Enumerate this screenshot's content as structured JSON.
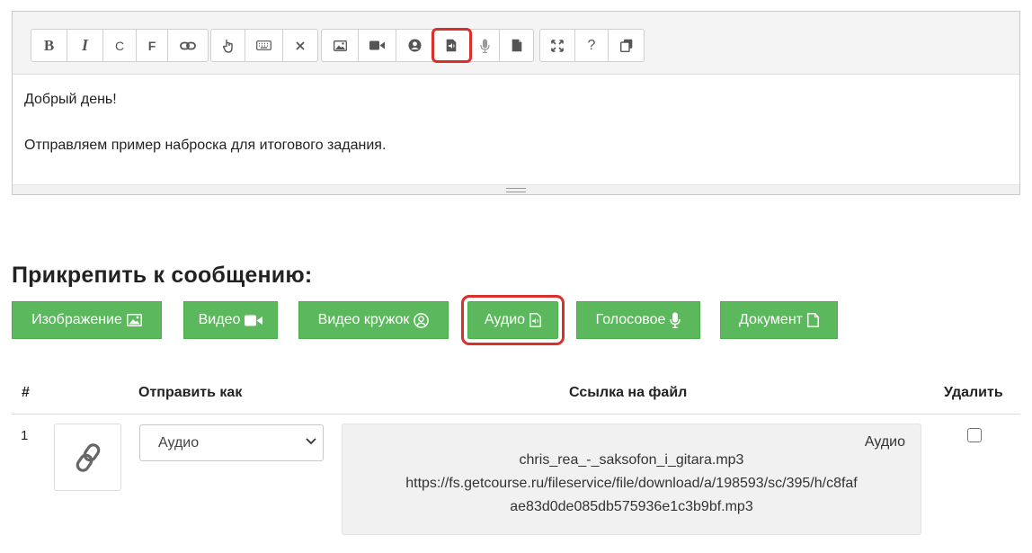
{
  "editor": {
    "toolbar": {
      "groups": [
        [
          {
            "name": "bold-button",
            "label": "B"
          },
          {
            "name": "italic-button",
            "label": "I"
          },
          {
            "name": "c-button",
            "label": "C"
          },
          {
            "name": "f-button",
            "label": "F"
          },
          {
            "name": "link-button",
            "icon": "link-icon"
          }
        ],
        [
          {
            "name": "pointer-button",
            "icon": "pointer-icon"
          },
          {
            "name": "keyboard-button",
            "icon": "keyboard-icon"
          },
          {
            "name": "clear-format-button",
            "icon": "close-icon"
          }
        ],
        [
          {
            "name": "image-button",
            "icon": "image-icon"
          },
          {
            "name": "video-button",
            "icon": "video-icon"
          },
          {
            "name": "user-circle-button",
            "icon": "user-circle-icon"
          },
          {
            "name": "audio-button",
            "icon": "audio-file-icon",
            "highlighted": true
          },
          {
            "name": "microphone-button",
            "icon": "microphone-icon"
          },
          {
            "name": "document-button",
            "icon": "file-icon"
          }
        ],
        [
          {
            "name": "fullscreen-button",
            "icon": "expand-icon"
          },
          {
            "name": "help-button",
            "label": "?"
          },
          {
            "name": "copy-button",
            "icon": "copy-icon"
          }
        ]
      ]
    },
    "content": {
      "line1": "Добрый день!",
      "line2": "Отправляем пример наброска для итогового задания."
    }
  },
  "attach": {
    "title": "Прикрепить к сообщению:",
    "buttons": {
      "image": {
        "label": "Изображение",
        "icon": "image-icon"
      },
      "video": {
        "label": "Видео",
        "icon": "video-camera-icon"
      },
      "video_circle": {
        "label": "Видео кружок",
        "icon": "user-circle-icon"
      },
      "audio": {
        "label": "Аудио",
        "icon": "audio-file-icon",
        "highlighted": true
      },
      "voice": {
        "label": "Голосовое",
        "icon": "microphone-icon"
      },
      "document": {
        "label": "Документ",
        "icon": "file-icon"
      }
    },
    "colors": {
      "button": "#5cb85c",
      "highlight": "#d9302c"
    }
  },
  "table": {
    "headers": {
      "num": "#",
      "send_as": "Отправить как",
      "link": "Ссылка на файл",
      "delete": "Удалить"
    },
    "rows": [
      {
        "num": "1",
        "thumb_icon": "link-icon",
        "send_as": "Аудио",
        "file_type": "Аудио",
        "file_name": "chris_rea_-_saksofon_i_gitara.mp3",
        "url_line1": "https://fs.getcourse.ru/fileservice/file/download/a/198593/sc/395/h/c8faf",
        "url_line2": "ae83d0de085db575936e1c3b9bf.mp3",
        "delete_checked": false
      }
    ]
  }
}
